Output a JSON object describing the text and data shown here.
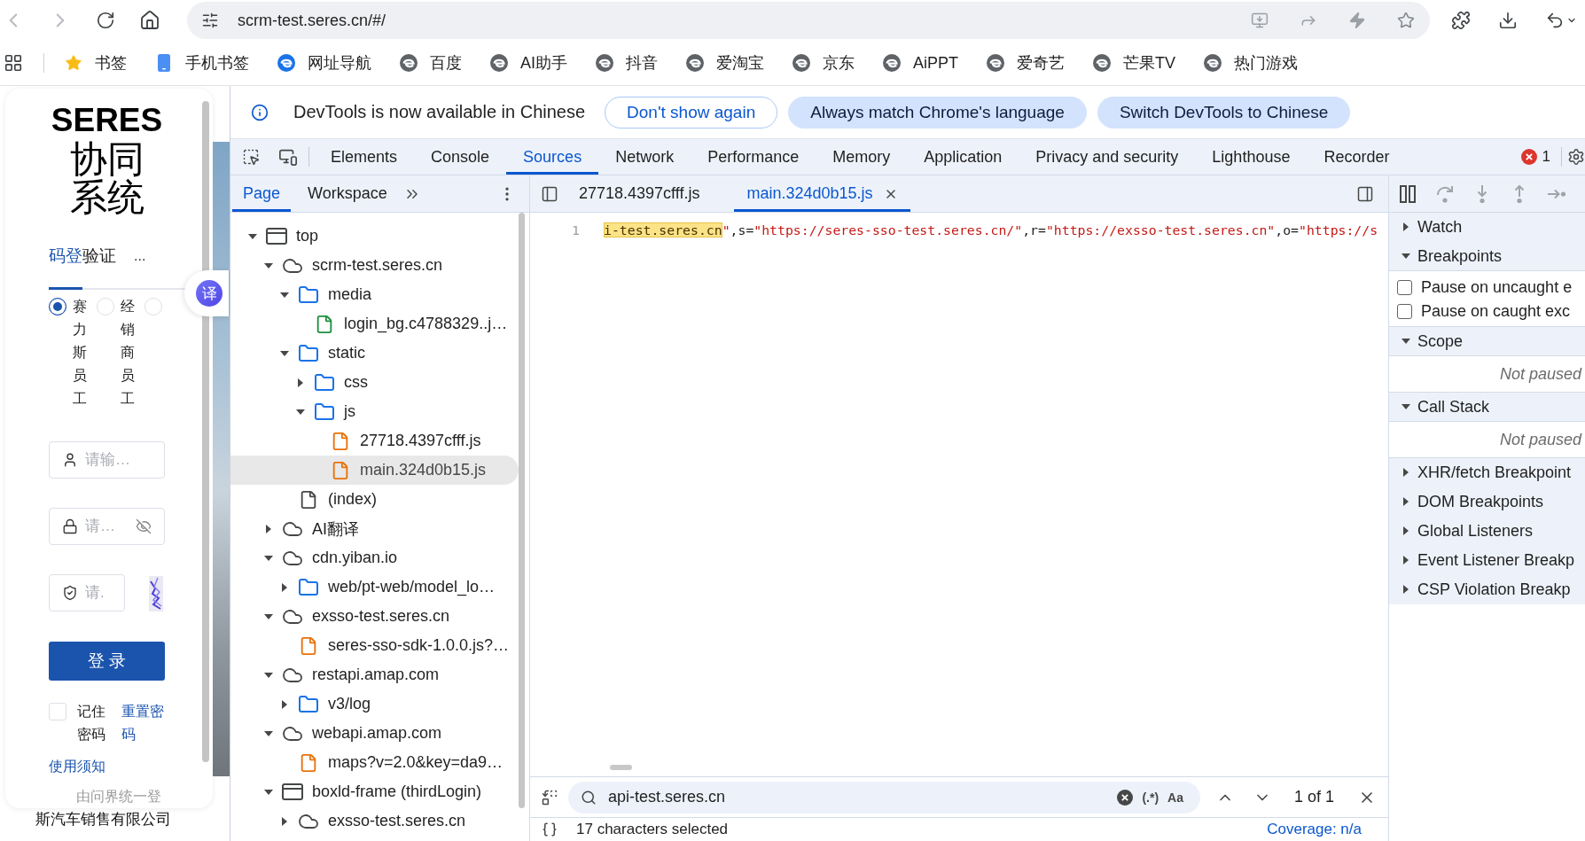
{
  "browser": {
    "nav_buttons": [
      {
        "kind": "back",
        "disabled": true
      },
      {
        "kind": "forward",
        "disabled": true
      },
      {
        "kind": "reload",
        "disabled": false
      },
      {
        "kind": "home",
        "disabled": false
      }
    ],
    "address": "scrm-test.seres.cn/#/",
    "bookmarks": [
      {
        "kind": "star",
        "label": "书签",
        "color": "#f9bc15"
      },
      {
        "kind": "phone",
        "label": "手机书签",
        "color": "#4b8ff5"
      },
      {
        "kind": "swirl",
        "label": "网址导航",
        "color": "#1a73e8"
      },
      {
        "kind": "swirl",
        "label": "百度",
        "color": "#5f6368"
      },
      {
        "kind": "swirl",
        "label": "AI助手",
        "color": "#5f6368"
      },
      {
        "kind": "swirl",
        "label": "抖音",
        "color": "#5f6368"
      },
      {
        "kind": "swirl",
        "label": "爱淘宝",
        "color": "#5f6368"
      },
      {
        "kind": "swirl",
        "label": "京东",
        "color": "#5f6368"
      },
      {
        "kind": "swirl",
        "label": "AiPPT",
        "color": "#5f6368"
      },
      {
        "kind": "swirl",
        "label": "爱奇艺",
        "color": "#5f6368"
      },
      {
        "kind": "swirl",
        "label": "芒果TV",
        "color": "#5f6368"
      },
      {
        "kind": "swirl",
        "label": "热门游戏",
        "color": "#5f6368"
      }
    ]
  },
  "login": {
    "logo_title": "SERES",
    "logo_subtitle": "协同系统",
    "tabs": [
      {
        "label": "码登",
        "selected": true
      },
      {
        "label": "验证",
        "selected": false
      }
    ],
    "tabs_more": "...",
    "user_types": [
      {
        "label": "赛力斯员工",
        "selected": true
      },
      {
        "label": "经销商员工",
        "selected": false
      },
      {
        "selected": false
      }
    ],
    "fields": [
      {
        "kind": "username",
        "placeholder": "请输…"
      },
      {
        "kind": "password",
        "placeholder": "请…"
      },
      {
        "kind": "captcha",
        "placeholder": "请."
      }
    ],
    "submit": "登 录",
    "remember": {
      "label": "记住密码",
      "checked": false
    },
    "reset_link": "重置密码",
    "notice_link": "使用须知",
    "sso_note": "由问界统一登",
    "footer": "斯汽车销售有限公司",
    "translate_button": "译"
  },
  "devtools": {
    "infobar": {
      "message": "DevTools is now available in Chinese",
      "buttons": [
        {
          "label": "Don't show again",
          "kind": "outlined"
        },
        {
          "label": "Always match Chrome's language",
          "kind": "filled"
        },
        {
          "label": "Switch DevTools to Chinese",
          "kind": "filled"
        }
      ]
    },
    "panels": [
      {
        "label": "Elements",
        "selected": false
      },
      {
        "label": "Console",
        "selected": false
      },
      {
        "label": "Sources",
        "selected": true
      },
      {
        "label": "Network",
        "selected": false
      },
      {
        "label": "Performance",
        "selected": false
      },
      {
        "label": "Memory",
        "selected": false
      },
      {
        "label": "Application",
        "selected": false
      },
      {
        "label": "Privacy and security",
        "selected": false
      },
      {
        "label": "Lighthouse",
        "selected": false
      },
      {
        "label": "Recorder",
        "selected": false
      }
    ],
    "error_count": "1",
    "navigator_tabs": [
      {
        "label": "Page",
        "selected": true
      },
      {
        "label": "Workspace",
        "selected": false
      }
    ],
    "editor_tabs": [
      {
        "label": "27718.4397cfff.js",
        "selected": false
      },
      {
        "label": "main.324d0b15.js",
        "selected": true
      }
    ],
    "tree": [
      {
        "label": "top",
        "kind": "frame",
        "expanded": true,
        "selected": false,
        "children": [
          {
            "label": "scrm-test.seres.cn",
            "kind": "domain",
            "expanded": true,
            "selected": false,
            "children": [
              {
                "label": "media",
                "kind": "folder",
                "expanded": true,
                "selected": false,
                "children": [
                  {
                    "label": "login_bg.c4788329..j…",
                    "kind": "image",
                    "selected": false
                  }
                ]
              },
              {
                "label": "static",
                "kind": "folder",
                "expanded": true,
                "selected": false,
                "children": [
                  {
                    "label": "css",
                    "kind": "folder",
                    "expanded": false,
                    "selected": false
                  },
                  {
                    "label": "js",
                    "kind": "folder",
                    "expanded": true,
                    "selected": false,
                    "children": [
                      {
                        "label": "27718.4397cfff.js",
                        "kind": "script",
                        "selected": false
                      },
                      {
                        "label": "main.324d0b15.js",
                        "kind": "script",
                        "selected": true
                      }
                    ]
                  }
                ]
              },
              {
                "label": "(index)",
                "kind": "document",
                "selected": false
              }
            ]
          },
          {
            "label": "AI翻译",
            "kind": "domain",
            "expanded": false,
            "selected": false
          },
          {
            "label": "cdn.yiban.io",
            "kind": "domain",
            "expanded": true,
            "selected": false,
            "children": [
              {
                "label": "web/pt-web/model_lo…",
                "kind": "folder",
                "expanded": false,
                "selected": false
              }
            ]
          },
          {
            "label": "exsso-test.seres.cn",
            "kind": "domain",
            "expanded": true,
            "selected": false,
            "children": [
              {
                "label": "seres-sso-sdk-1.0.0.js?…",
                "kind": "script",
                "selected": false
              }
            ]
          },
          {
            "label": "restapi.amap.com",
            "kind": "domain",
            "expanded": true,
            "selected": false,
            "children": [
              {
                "label": "v3/log",
                "kind": "folder",
                "expanded": false,
                "selected": false
              }
            ]
          },
          {
            "label": "webapi.amap.com",
            "kind": "domain",
            "expanded": true,
            "selected": false,
            "children": [
              {
                "label": "maps?v=2.0&key=da9…",
                "kind": "script",
                "selected": false
              }
            ]
          },
          {
            "label": "boxld-frame (thirdLogin)",
            "kind": "frame",
            "expanded": true,
            "selected": false,
            "children": [
              {
                "label": "exsso-test.seres.cn",
                "kind": "domain",
                "expanded": false,
                "selected": false
              }
            ]
          }
        ]
      }
    ],
    "code_lines": [
      {
        "number": "1",
        "tokens": [
          {
            "kind": "match",
            "text": "i-test.seres.cn"
          },
          {
            "kind": "string",
            "text": "\""
          },
          {
            "kind": "plain",
            "text": ",s="
          },
          {
            "kind": "string",
            "text": "\"https://seres-sso-test.seres.cn/\""
          },
          {
            "kind": "plain",
            "text": ",r="
          },
          {
            "kind": "string",
            "text": "\"https://exsso-test.seres.cn\""
          },
          {
            "kind": "plain",
            "text": ",o="
          },
          {
            "kind": "string",
            "text": "\"https://s"
          }
        ]
      }
    ],
    "search": {
      "value": "api-test.seres.cn",
      "regex_toggle": "(.*)",
      "case_toggle": "Aa",
      "result": "1 of 1"
    },
    "status": {
      "selection": "17 characters selected",
      "coverage": "Coverage: n/a"
    },
    "debugger_controls": [
      {
        "kind": "pause",
        "disabled": false
      },
      {
        "kind": "step_over",
        "disabled": true
      },
      {
        "kind": "step_into",
        "disabled": true
      },
      {
        "kind": "step_out",
        "disabled": true
      },
      {
        "kind": "step",
        "disabled": true
      }
    ],
    "debugger_sections": [
      {
        "title": "Watch",
        "expanded": false
      },
      {
        "title": "Breakpoints",
        "expanded": true,
        "options": [
          {
            "label": "Pause on uncaught e",
            "checked": false
          },
          {
            "label": "Pause on caught exc",
            "checked": false
          }
        ]
      },
      {
        "title": "Scope",
        "expanded": true,
        "message": "Not paused"
      },
      {
        "title": "Call Stack",
        "expanded": true,
        "message": "Not paused"
      },
      {
        "title": "XHR/fetch Breakpoint",
        "expanded": false
      },
      {
        "title": "DOM Breakpoints",
        "expanded": false
      },
      {
        "title": "Global Listeners",
        "expanded": false
      },
      {
        "title": "Event Listener Breakp",
        "expanded": false
      },
      {
        "title": "CSP Violation Breakp",
        "expanded": false
      }
    ]
  }
}
